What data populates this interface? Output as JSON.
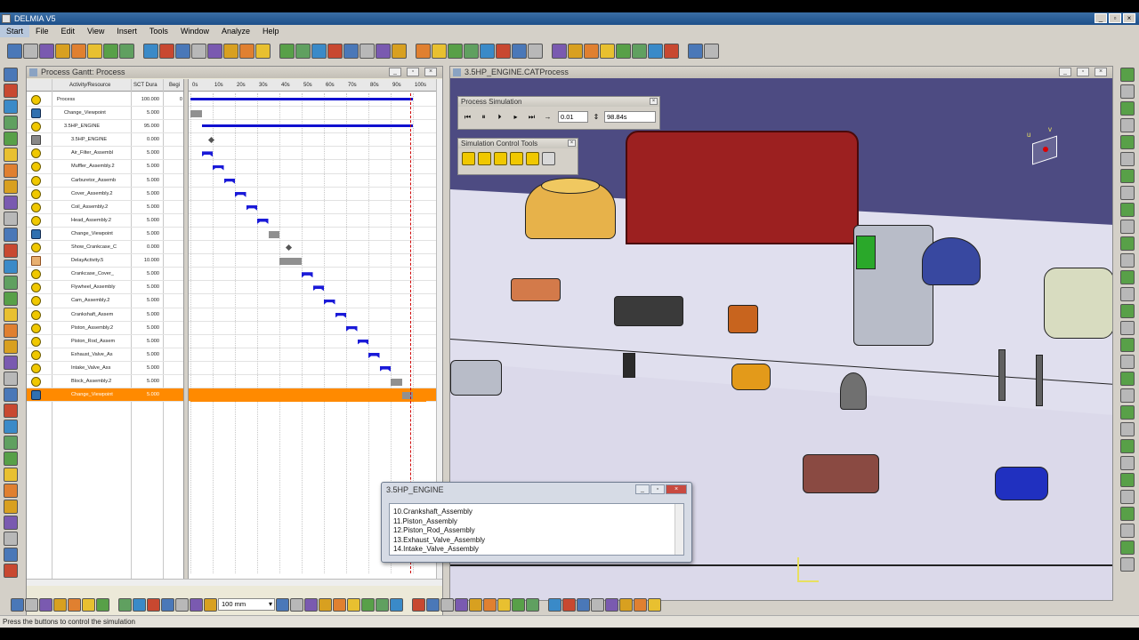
{
  "app": {
    "title": "DELMIA V5"
  },
  "menu": [
    "Start",
    "File",
    "Edit",
    "View",
    "Insert",
    "Tools",
    "Window",
    "Analyze",
    "Help"
  ],
  "gantt": {
    "title": "Process Gantt: Process",
    "columns": {
      "activity": "Activity/Resource",
      "duration": "SCT Dura",
      "begin": "Begi"
    },
    "timeline_labels": [
      "0s",
      "10s",
      "20s",
      "30s",
      "40s",
      "50s",
      "60s",
      "70s",
      "80s",
      "90s",
      "100s"
    ],
    "rows": [
      {
        "name": "Process",
        "duration": "100.000",
        "begin": "0",
        "icon": "assembly",
        "indent": 0,
        "bar": {
          "kind": "summary",
          "start": 0,
          "end": 100
        }
      },
      {
        "name": "Change_Viewpoint",
        "duration": "5.000",
        "begin": "",
        "icon": "camera",
        "indent": 1,
        "bar": {
          "kind": "grey",
          "start": 0,
          "end": 5
        }
      },
      {
        "name": "3.5HP_ENGINE",
        "duration": "95.000",
        "begin": "",
        "icon": "assembly",
        "indent": 1,
        "bar": {
          "kind": "summary",
          "start": 5,
          "end": 100
        }
      },
      {
        "name": "3.5HP_ENGINE",
        "duration": "0.000",
        "begin": "",
        "icon": "text",
        "indent": 2,
        "bar": {
          "kind": "milestone",
          "start": 5,
          "end": 5
        }
      },
      {
        "name": "Air_Filter_Assembl",
        "duration": "5.000",
        "begin": "",
        "icon": "assembly",
        "indent": 2,
        "bar": {
          "kind": "task",
          "start": 5,
          "end": 10
        }
      },
      {
        "name": "Muffler_Assembly.2",
        "duration": "5.000",
        "begin": "",
        "icon": "assembly",
        "indent": 2,
        "bar": {
          "kind": "task",
          "start": 10,
          "end": 15
        }
      },
      {
        "name": "Carburetor_Assemb",
        "duration": "5.000",
        "begin": "",
        "icon": "assembly",
        "indent": 2,
        "bar": {
          "kind": "task",
          "start": 15,
          "end": 20
        }
      },
      {
        "name": "Cover_Assembly.2",
        "duration": "5.000",
        "begin": "",
        "icon": "assembly",
        "indent": 2,
        "bar": {
          "kind": "task",
          "start": 20,
          "end": 25
        }
      },
      {
        "name": "Coil_Assembly.2",
        "duration": "5.000",
        "begin": "",
        "icon": "assembly",
        "indent": 2,
        "bar": {
          "kind": "task",
          "start": 25,
          "end": 30
        }
      },
      {
        "name": "Head_Assembly.2",
        "duration": "5.000",
        "begin": "",
        "icon": "assembly",
        "indent": 2,
        "bar": {
          "kind": "task",
          "start": 30,
          "end": 35
        }
      },
      {
        "name": "Change_Viewpoint",
        "duration": "5.000",
        "begin": "",
        "icon": "camera",
        "indent": 2,
        "bar": {
          "kind": "grey",
          "start": 35,
          "end": 40
        }
      },
      {
        "name": "Show_Crankcase_C",
        "duration": "0.000",
        "begin": "",
        "icon": "assembly",
        "indent": 2,
        "bar": {
          "kind": "milestone",
          "start": 40,
          "end": 40
        }
      },
      {
        "name": "DelayActivity.5",
        "duration": "10.000",
        "begin": "",
        "icon": "delay",
        "indent": 2,
        "bar": {
          "kind": "grey",
          "start": 40,
          "end": 50
        }
      },
      {
        "name": "Crankcase_Cover_",
        "duration": "5.000",
        "begin": "",
        "icon": "assembly",
        "indent": 2,
        "bar": {
          "kind": "task",
          "start": 50,
          "end": 55
        }
      },
      {
        "name": "Flywheel_Assembly",
        "duration": "5.000",
        "begin": "",
        "icon": "assembly",
        "indent": 2,
        "bar": {
          "kind": "task",
          "start": 55,
          "end": 60
        }
      },
      {
        "name": "Cam_Assembly.2",
        "duration": "5.000",
        "begin": "",
        "icon": "assembly",
        "indent": 2,
        "bar": {
          "kind": "task",
          "start": 60,
          "end": 65
        }
      },
      {
        "name": "Crankshaft_Assem",
        "duration": "5.000",
        "begin": "",
        "icon": "assembly",
        "indent": 2,
        "bar": {
          "kind": "task",
          "start": 65,
          "end": 70
        }
      },
      {
        "name": "Piston_Assembly.2",
        "duration": "5.000",
        "begin": "",
        "icon": "assembly",
        "indent": 2,
        "bar": {
          "kind": "task",
          "start": 70,
          "end": 75
        }
      },
      {
        "name": "Piston_Rod_Assem",
        "duration": "5.000",
        "begin": "",
        "icon": "assembly",
        "indent": 2,
        "bar": {
          "kind": "task",
          "start": 75,
          "end": 80
        }
      },
      {
        "name": "Exhaust_Valve_As",
        "duration": "5.000",
        "begin": "",
        "icon": "assembly",
        "indent": 2,
        "bar": {
          "kind": "task",
          "start": 80,
          "end": 85
        }
      },
      {
        "name": "Intake_Valve_Ass",
        "duration": "5.000",
        "begin": "",
        "icon": "assembly",
        "indent": 2,
        "bar": {
          "kind": "task",
          "start": 85,
          "end": 90
        }
      },
      {
        "name": "Block_Assembly.2",
        "duration": "5.000",
        "begin": "",
        "icon": "assembly",
        "indent": 2,
        "bar": {
          "kind": "grey",
          "start": 90,
          "end": 95
        }
      },
      {
        "name": "Change_Viewpoint",
        "duration": "5.000",
        "begin": "",
        "icon": "camera",
        "indent": 2,
        "selected": true,
        "bar": {
          "kind": "grey",
          "start": 95,
          "end": 100
        }
      }
    ],
    "current_time": 98.84
  },
  "viewer": {
    "title": "3.5HP_ENGINE.CATProcess",
    "simulation": {
      "title": "Process Simulation",
      "step": "0.01",
      "time": "98.84s"
    },
    "sim_tools": {
      "title": "Simulation Control Tools"
    },
    "compass": {
      "u": "u",
      "v": "v"
    }
  },
  "dialog": {
    "title": "3.5HP_ENGINE",
    "items": [
      "10.Crankshaft_Assembly",
      "11.Piston_Assembly",
      "12.Piston_Rod_Assembly",
      "13.Exhaust_Valve_Assembly",
      "14.Intake_Valve_Assembly"
    ]
  },
  "bottom": {
    "unit": "100 mm"
  },
  "status": {
    "text": "Press the buttons to control the simulation"
  },
  "colors": {
    "background3d": "#4d4b82",
    "selection": "#ff8a00",
    "task_bar": "#1a1ad8",
    "time_cursor": "#d00000"
  }
}
